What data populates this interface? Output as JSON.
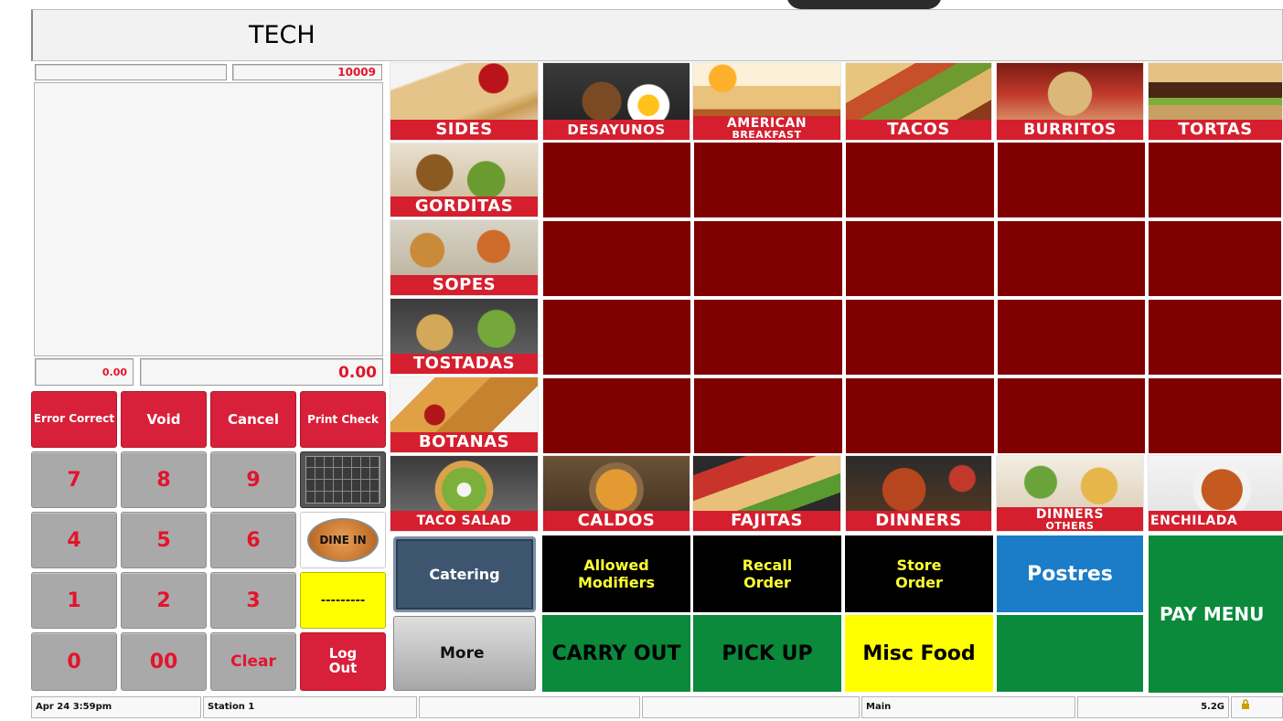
{
  "header": {
    "title": "TECH"
  },
  "check": {
    "check_number": "10009",
    "tax": "0.00",
    "total": "0.00"
  },
  "keypad": {
    "error_correct": "Error Correct",
    "void": "Void",
    "cancel": "Cancel",
    "print_check": "Print Check",
    "seven": "7",
    "eight": "8",
    "nine": "9",
    "four": "4",
    "five": "5",
    "six": "6",
    "one": "1",
    "two": "2",
    "three": "3",
    "zero": "0",
    "double_zero": "00",
    "clear": "Clear",
    "dine_in": "DINE IN",
    "dashes": "---------",
    "log_out": "Log Out"
  },
  "categories": {
    "sides": "SIDES",
    "desayunos": "DESAYUNOS",
    "american_1": "AMERICAN",
    "american_2": "BREAKFAST",
    "tacos": "TACOS",
    "burritos": "BURRITOS",
    "tortas": "TORTAS",
    "gorditas": "GORDITAS",
    "sopes": "SOPES",
    "tostadas": "TOSTADAS",
    "botanas": "BOTANAS",
    "taco_salad": "TACO SALAD",
    "caldos": "CALDOS",
    "fajitas": "FAJITAS",
    "dinners": "DINNERS",
    "dinners_others_1": "DINNERS",
    "dinners_others_2": "OTHERS",
    "enchiladas": "ENCHILADA"
  },
  "functions": {
    "catering": "Catering",
    "allowed_modifiers": "Allowed Modifiers",
    "recall_order": "Recall Order",
    "store_order": "Store Order",
    "postres": "Postres",
    "pay_menu": "PAY MENU",
    "more": "More",
    "carry_out": "CARRY OUT",
    "pick_up": "PICK UP",
    "misc_food": "Misc Food"
  },
  "status": {
    "datetime": "Apr 24  3:59pm",
    "station": "Station 1",
    "mode": "Main",
    "version": "5.2G"
  },
  "colors": {
    "tile_red": "#d51f2e",
    "empty_tile": "#800000",
    "key_red": "#d8203a",
    "green": "#0a8a3a",
    "blue": "#1b7cc7",
    "yellow": "#ffff00"
  }
}
